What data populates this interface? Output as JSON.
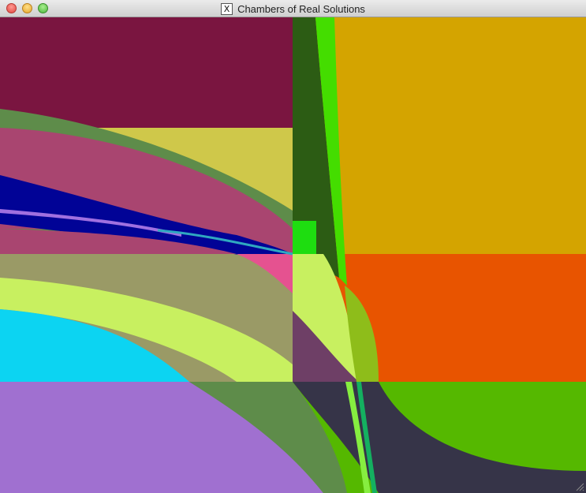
{
  "window": {
    "title": "Chambers of Real Solutions",
    "title_icon": "X",
    "controls": [
      "close",
      "minimize",
      "zoom"
    ]
  },
  "plot": {
    "description_colors": {
      "maroon": "#7a1540",
      "mustard": "#d4a400",
      "orange": "#e85400",
      "green": "#55b800",
      "olive_green": "#5e8c4a",
      "khaki": "#cfc84a",
      "rose": "#a94570",
      "navy": "#010396",
      "pink": "#e55290",
      "sage": "#9a9a66",
      "lime": "#c8f060",
      "cyan": "#0cd4f2",
      "lavender": "#a070d0",
      "dark_slate": "#363448",
      "bright_green": "#44dd00",
      "dark_forest": "#2c5c14",
      "plum": "#6e3f66"
    }
  }
}
